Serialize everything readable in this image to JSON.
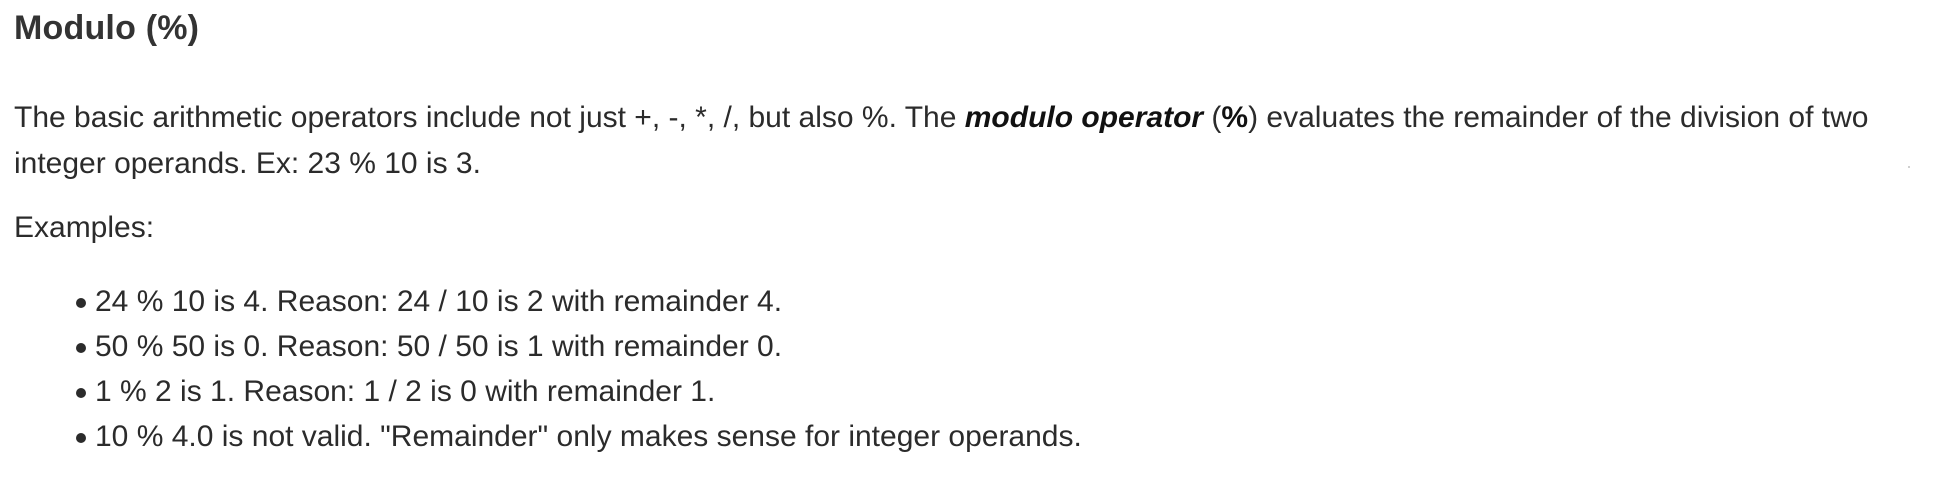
{
  "section": {
    "title": "Modulo (%)"
  },
  "intro": {
    "before": "The basic arithmetic operators include not just +, -, *, /, but also %. The ",
    "term": "modulo operator",
    "paren_open": " (",
    "symbol": "%",
    "after": ") evaluates the remainder of the division of two integer operands. Ex: 23 % 10 is 3."
  },
  "examples": {
    "label": "Examples:",
    "items": [
      "24 % 10 is 4. Reason: 24 / 10 is 2 with remainder 4.",
      "50 % 50 is 0. Reason: 50 / 50 is 1 with remainder 0.",
      "1 % 2 is 1. Reason: 1 / 2 is 0 with remainder 1.",
      "10 % 4.0 is not valid. \"Remainder\" only makes sense for integer operands."
    ]
  }
}
